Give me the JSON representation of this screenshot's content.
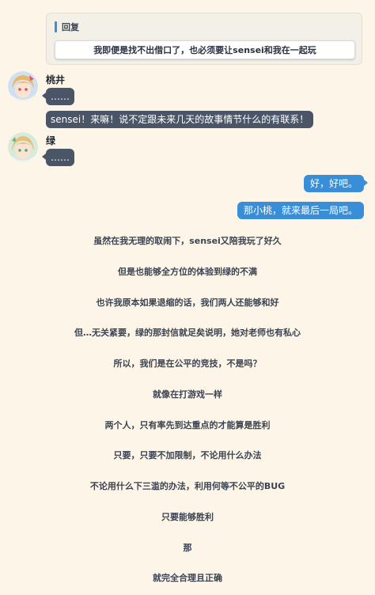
{
  "reply": {
    "title": "回复",
    "option": "我即便是找不出借口了，也必须要让sensei和我在一起玩"
  },
  "messages": [
    {
      "speaker": "桃井",
      "text": "……"
    },
    {
      "speaker": "桃井",
      "text": "sensei！来嘛！说不定跟未来几天的故事情节什么的有联系！"
    },
    {
      "speaker": "绿",
      "text": "……"
    }
  ],
  "player_messages": [
    "好，好吧。",
    "那小桃，就来最后一局吧。"
  ],
  "narration": [
    "虽然在我无理的取闹下，sensei又陪我玩了好久",
    "但是也能够全方位的体验到绿的不满",
    "也许我原本如果退缩的话，我们两人还能够和好",
    "但…无关紧要，绿的那封信就足矣说明，她对老师也有私心",
    "所以，我们是在公平的竞技，不是吗？",
    "就像在打游戏一样",
    "两个人，只有率先到达重点的才能算是胜利",
    "只要，只要不加限制，不论用什么办法",
    "不论用什么下三滥的办法，利用何等不公平的BUG",
    "只要能够胜利",
    "那",
    "就完全合理且正确"
  ],
  "colors": {
    "player_bubble": "#3a8ed8",
    "npc_bubble": "#4a5567",
    "background": "#fdf6e8"
  }
}
